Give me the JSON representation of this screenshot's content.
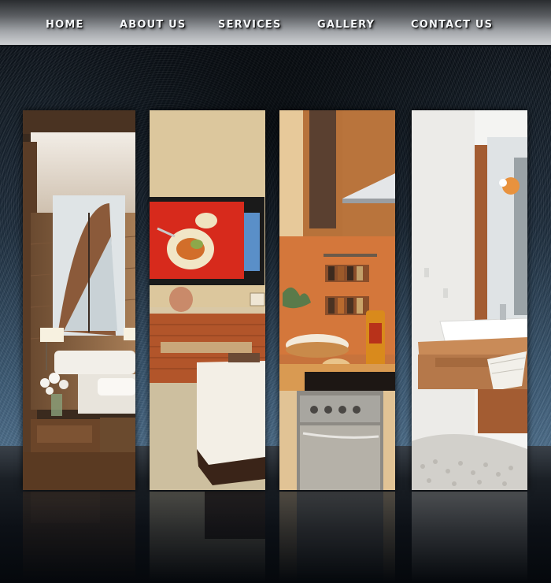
{
  "nav": {
    "items": [
      {
        "label": "HOME"
      },
      {
        "label": "ABOUT US"
      },
      {
        "label": "SERVICES"
      },
      {
        "label": "GALLERY"
      },
      {
        "label": "CONTACT US"
      }
    ]
  },
  "gallery": {
    "panels": [
      {
        "subject": "bedroom"
      },
      {
        "subject": "living-room"
      },
      {
        "subject": "kitchen"
      },
      {
        "subject": "bathroom"
      }
    ]
  }
}
